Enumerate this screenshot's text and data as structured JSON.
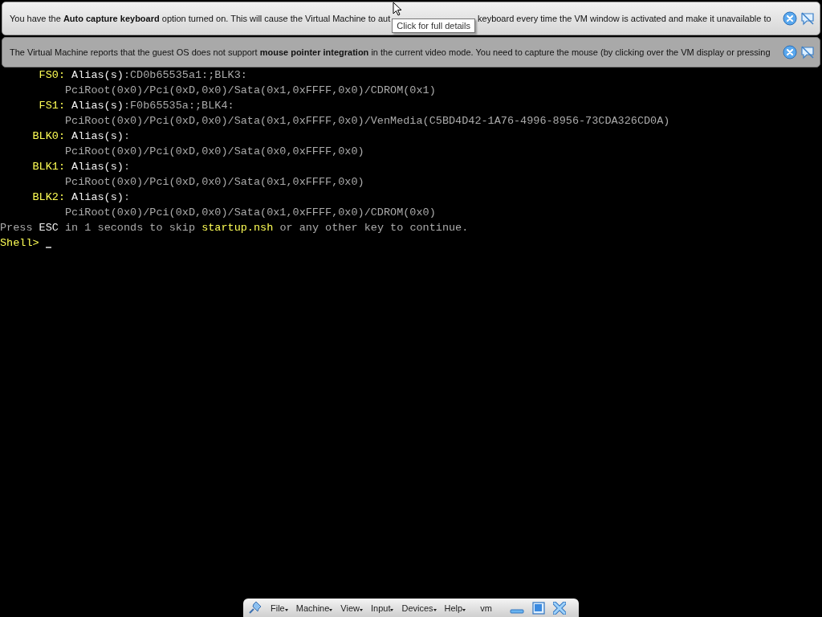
{
  "banners": [
    {
      "texts": [
        "You have the **Auto capture keyboard** option turned on. This will cause the Virtual Machine to aut",
        "keyboard every time the VM window is activated and make it unavailable to"
      ],
      "kind": "active",
      "tooltip": "Click for full details"
    },
    {
      "texts": [
        "The Virtual Machine reports that the guest OS does not support **mouse pointer integration** in the current video mode. You need to capture the mouse (by clicking over the VM display or pressing"
      ],
      "kind": "inactive"
    }
  ],
  "console": {
    "mappings": [
      {
        "label": "FS0:",
        "alias": "Alias(s)",
        "alias_value": ":CD0b65535a1:;BLK3:",
        "path": "PciRoot(0x0)/Pci(0xD,0x0)/Sata(0x1,0xFFFF,0x0)/CDROM(0x1)"
      },
      {
        "label": "FS1:",
        "alias": "Alias(s)",
        "alias_value": ":F0b65535a:;BLK4:",
        "path": "PciRoot(0x0)/Pci(0xD,0x0)/Sata(0x1,0xFFFF,0x0)/VenMedia(C5BD4D42-1A76-4996-8956-73CDA326CD0A)"
      },
      {
        "label": "BLK0:",
        "alias": "Alias(s)",
        "alias_value": ":",
        "path": "PciRoot(0x0)/Pci(0xD,0x0)/Sata(0x0,0xFFFF,0x0)"
      },
      {
        "label": "BLK1:",
        "alias": "Alias(s)",
        "alias_value": ":",
        "path": "PciRoot(0x0)/Pci(0xD,0x0)/Sata(0x1,0xFFFF,0x0)"
      },
      {
        "label": "BLK2:",
        "alias": "Alias(s)",
        "alias_value": ":",
        "path": "PciRoot(0x0)/Pci(0xD,0x0)/Sata(0x1,0xFFFF,0x0)/CDROM(0x0)"
      }
    ],
    "message": [
      {
        "text": "Press ",
        "kind": "plain"
      },
      {
        "text": "ESC",
        "kind": "key"
      },
      {
        "text": " in 1 seconds to skip ",
        "kind": "plain"
      },
      {
        "text": "startup.nsh",
        "kind": "highlight"
      },
      {
        "text": " or any other key to continue.",
        "kind": "plain"
      }
    ],
    "prompt": "Shell>"
  },
  "toolbar": {
    "menus": [
      "File",
      "Machine",
      "View",
      "Input",
      "Devices",
      "Help"
    ],
    "vm_name": "vm"
  }
}
